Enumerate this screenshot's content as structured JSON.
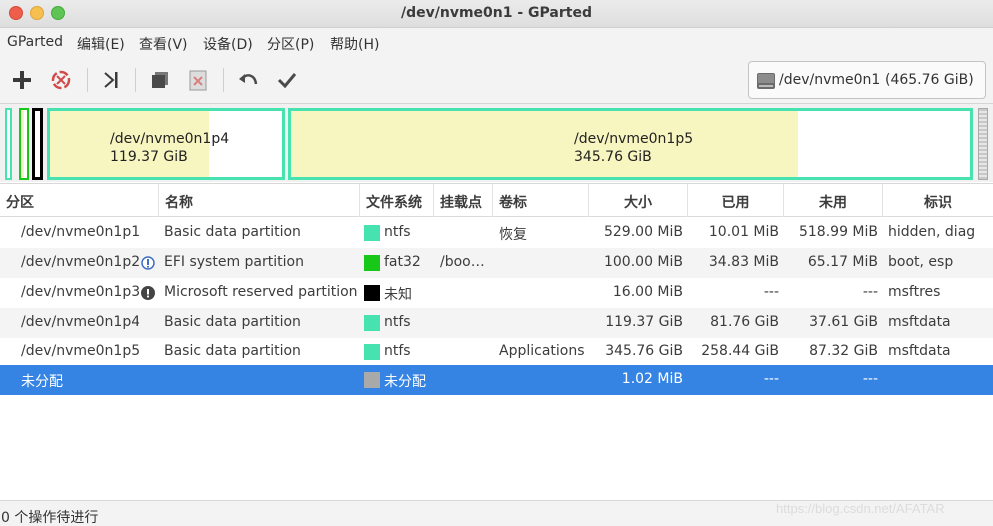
{
  "window": {
    "title": "/dev/nvme0n1 - GParted"
  },
  "menu": {
    "items": [
      "GParted",
      "编辑(E)",
      "查看(V)",
      "设备(D)",
      "分区(P)",
      "帮助(H)"
    ]
  },
  "toolbar": {
    "icons": [
      "add-icon",
      "delete-icon",
      "resize-move-icon",
      "copy-icon",
      "paste-icon",
      "undo-icon",
      "apply-icon"
    ]
  },
  "device": {
    "name": "/dev/nvme0n1",
    "size": "(465.76 GiB)"
  },
  "diskmap": {
    "p4": {
      "name": "/dev/nvme0n1p4",
      "size": "119.37 GiB",
      "used_fraction": 0.685
    },
    "p5": {
      "name": "/dev/nvme0n1p5",
      "size": "345.76 GiB",
      "used_fraction": 0.747
    }
  },
  "table": {
    "headers": [
      "分区",
      "名称",
      "文件系统",
      "挂载点",
      "卷标",
      "大小",
      "已用",
      "未用",
      "标识"
    ],
    "rows": [
      {
        "partition": "/dev/nvme0n1p1",
        "name": "Basic data partition",
        "fs": "ntfs",
        "fs_color": "#46e3b0",
        "mount": "",
        "label": "恢复",
        "size": "529.00 MiB",
        "used": "10.01 MiB",
        "unused": "518.99 MiB",
        "flags": "hidden, diag",
        "badge": ""
      },
      {
        "partition": "/dev/nvme0n1p2",
        "name": "EFI system partition",
        "fs": "fat32",
        "fs_color": "#18c818",
        "mount": "/boo…",
        "label": "",
        "size": "100.00 MiB",
        "used": "34.83 MiB",
        "unused": "65.17 MiB",
        "flags": "boot, esp",
        "badge": "info-icon"
      },
      {
        "partition": "/dev/nvme0n1p3",
        "name": "Microsoft reserved partition",
        "fs": "未知",
        "fs_color": "#000000",
        "mount": "",
        "label": "",
        "size": "16.00 MiB",
        "used": "---",
        "unused": "---",
        "flags": "msftres",
        "badge": "warning-icon"
      },
      {
        "partition": "/dev/nvme0n1p4",
        "name": "Basic data partition",
        "fs": "ntfs",
        "fs_color": "#46e3b0",
        "mount": "",
        "label": "",
        "size": "119.37 GiB",
        "used": "81.76 GiB",
        "unused": "37.61 GiB",
        "flags": "msftdata",
        "badge": ""
      },
      {
        "partition": "/dev/nvme0n1p5",
        "name": "Basic data partition",
        "fs": "ntfs",
        "fs_color": "#46e3b0",
        "mount": "",
        "label": "Applications",
        "size": "345.76 GiB",
        "used": "258.44 GiB",
        "unused": "87.32 GiB",
        "flags": "msftdata",
        "badge": ""
      },
      {
        "partition": "未分配",
        "name": "",
        "fs": "未分配",
        "fs_color": "#a9a9a9",
        "mount": "",
        "label": "",
        "size": "1.02 MiB",
        "used": "---",
        "unused": "---",
        "flags": "",
        "badge": ""
      }
    ]
  },
  "status": {
    "text": "0 个操作待进行",
    "watermark": "https://blog.csdn.net/AFATAR"
  }
}
